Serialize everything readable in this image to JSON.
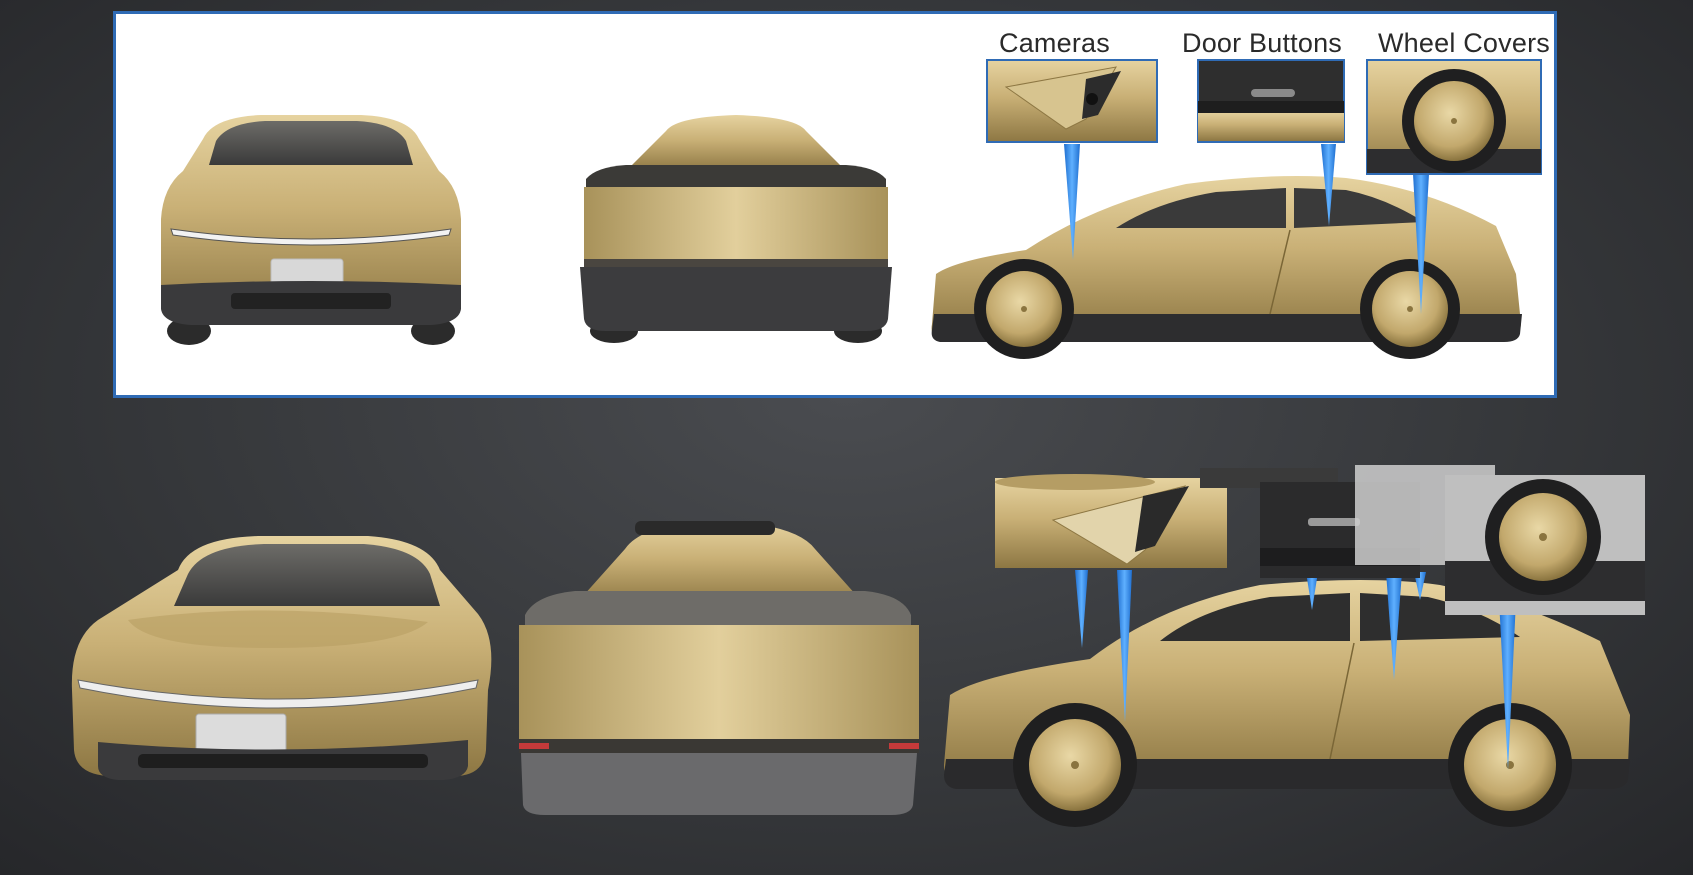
{
  "callouts": {
    "cameras": "Cameras",
    "door_buttons": "Door Buttons",
    "wheel_covers": "Wheel Covers"
  },
  "colors": {
    "body_gold": "#c6ad72",
    "body_gold_light": "#e3cf98",
    "body_gold_dark": "#8f7a45",
    "trim_dark": "#2e2e30",
    "callout_blue": "#3a8ee6",
    "panel_border": "#2f6bb5",
    "background": "#35373a"
  }
}
